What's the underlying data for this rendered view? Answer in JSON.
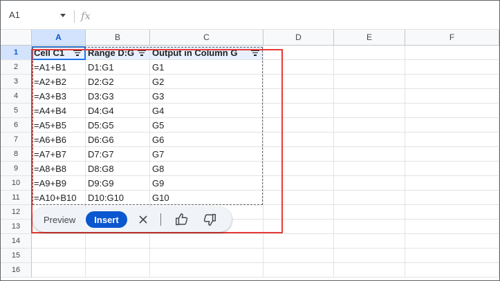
{
  "name_box": {
    "value": "A1"
  },
  "formula_bar": {
    "fx_label": "fx",
    "value": ""
  },
  "columns": [
    "A",
    "B",
    "C",
    "D",
    "E",
    "F"
  ],
  "rows": [
    "1",
    "2",
    "3",
    "4",
    "5",
    "6",
    "7",
    "8",
    "9",
    "10",
    "11",
    "12",
    "13",
    "14",
    "15",
    "16"
  ],
  "selected_cell": "A1",
  "table": {
    "headers": [
      "Cell C1",
      "Range D:G",
      "Output in Column G"
    ],
    "rows": [
      [
        "=A1+B1",
        "D1:G1",
        "G1"
      ],
      [
        "=A2+B2",
        "D2:G2",
        "G2"
      ],
      [
        "=A3+B3",
        "D3:G3",
        "G3"
      ],
      [
        "=A4+B4",
        "D4:G4",
        "G4"
      ],
      [
        "=A5+B5",
        "D5:G5",
        "G5"
      ],
      [
        "=A6+B6",
        "D6:G6",
        "G6"
      ],
      [
        "=A7+B7",
        "D7:G7",
        "G7"
      ],
      [
        "=A8+B8",
        "D8:G8",
        "G8"
      ],
      [
        "=A9+B9",
        "D9:G9",
        "G9"
      ],
      [
        "=A10+B10",
        "D10:G10",
        "G10"
      ]
    ]
  },
  "suggestion_bar": {
    "preview_label": "Preview",
    "insert_label": "Insert",
    "dismiss_icon": "close-icon",
    "like_icon": "thumbs-up-icon",
    "dislike_icon": "thumbs-down-icon"
  },
  "colors": {
    "accent": "#0b57d0",
    "selection": "#1a73e8",
    "highlight_box": "#e53935",
    "header_fill": "#e8f0fe"
  }
}
